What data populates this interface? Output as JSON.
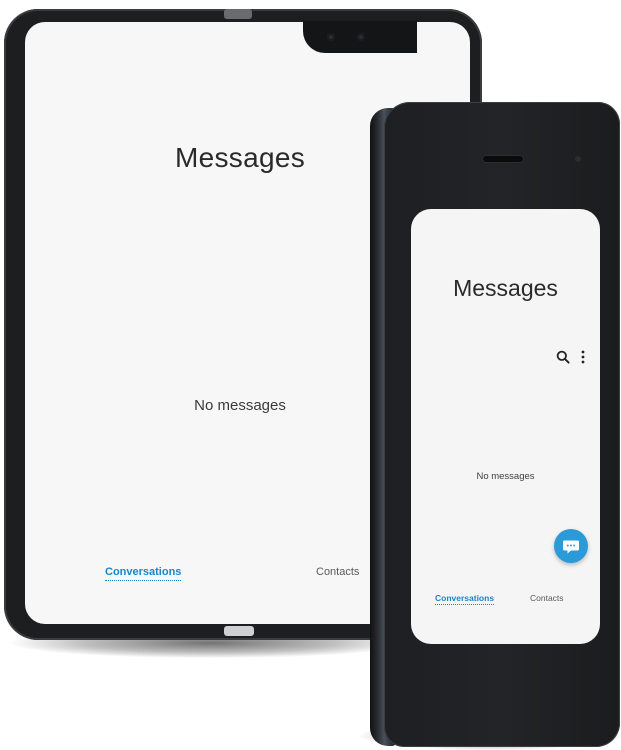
{
  "tablet": {
    "title": "Messages",
    "empty_state": "No messages",
    "tabs": [
      {
        "label": "Conversations",
        "active": true
      },
      {
        "label": "Contacts",
        "active": false
      }
    ]
  },
  "phone": {
    "title": "Messages",
    "empty_state": "No messages",
    "toolbar_icons": [
      "search-icon",
      "more-options-icon"
    ],
    "fab_icon": "compose-message-icon",
    "tabs": [
      {
        "label": "Conversations",
        "active": true
      },
      {
        "label": "Contacts",
        "active": false
      }
    ]
  },
  "colors": {
    "accent": "#1a86c9",
    "fab": "#2a9ad8",
    "screen_bg": "#f7f7f7",
    "device_body": "#1d1e20"
  }
}
